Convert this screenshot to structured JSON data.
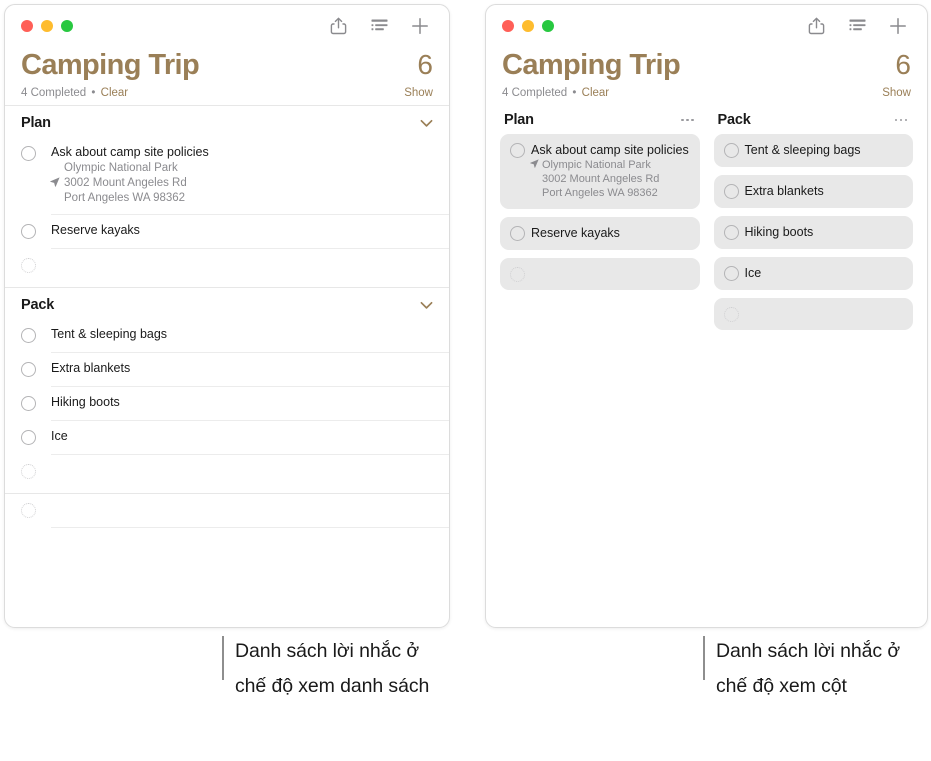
{
  "window_controls": {
    "close": "close-button",
    "minimize": "minimize-button",
    "zoom": "zoom-button"
  },
  "toolbar": {
    "share_label": "Share",
    "view_options_label": "View Options",
    "add_label": "Add Reminder"
  },
  "header": {
    "title": "Camping Trip",
    "count": "6",
    "completed_text": "4 Completed",
    "separator": "•",
    "clear_label": "Clear",
    "show_label": "Show"
  },
  "colors": {
    "accent": "#9a7f57",
    "title": "#9a7f57",
    "card_bg": "#e8e8e8",
    "secondary_text": "#8b8b8f",
    "traffic_red": "#ff5f57",
    "traffic_yellow": "#febc2e",
    "traffic_green": "#28c840"
  },
  "list_view": {
    "sections": [
      {
        "name": "Plan",
        "collapse_icon": "chevron-down-icon",
        "items": [
          {
            "title": "Ask about camp site policies",
            "location_lines": [
              "Olympic National Park",
              "3002 Mount Angeles Rd",
              "Port Angeles WA 98362"
            ],
            "arrow_on_line": 1,
            "checked": false
          },
          {
            "title": "Reserve kayaks",
            "location_lines": [],
            "checked": false
          }
        ],
        "new_item_placeholder": ""
      },
      {
        "name": "Pack",
        "collapse_icon": "chevron-down-icon",
        "items": [
          {
            "title": "Tent & sleeping bags",
            "location_lines": [],
            "checked": false
          },
          {
            "title": "Extra blankets",
            "location_lines": [],
            "checked": false
          },
          {
            "title": "Hiking boots",
            "location_lines": [],
            "checked": false
          },
          {
            "title": "Ice",
            "location_lines": [],
            "checked": false
          }
        ],
        "new_item_placeholder": ""
      }
    ],
    "trailing_new_item_placeholder": ""
  },
  "column_view": {
    "columns": [
      {
        "name": "Plan",
        "menu_icon": "ellipsis-icon",
        "items": [
          {
            "title": "Ask about camp site policies",
            "location_lines": [
              "Olympic National Park",
              "3002 Mount Angeles Rd",
              "Port Angeles WA 98362"
            ],
            "arrow_on_line": 0,
            "checked": false
          },
          {
            "title": "Reserve kayaks",
            "location_lines": [],
            "checked": false
          }
        ],
        "new_item_placeholder": ""
      },
      {
        "name": "Pack",
        "menu_icon": "ellipsis-icon",
        "items": [
          {
            "title": "Tent & sleeping bags",
            "location_lines": [],
            "checked": false
          },
          {
            "title": "Extra blankets",
            "location_lines": [],
            "checked": false
          },
          {
            "title": "Hiking boots",
            "location_lines": [],
            "checked": false
          },
          {
            "title": "Ice",
            "location_lines": [],
            "checked": false
          }
        ],
        "new_item_placeholder": ""
      }
    ]
  },
  "callouts": {
    "list_view": "Danh sách lời nhắc ở chế độ xem danh sách",
    "column_view": "Danh sách lời nhắc ở chế độ xem cột"
  }
}
